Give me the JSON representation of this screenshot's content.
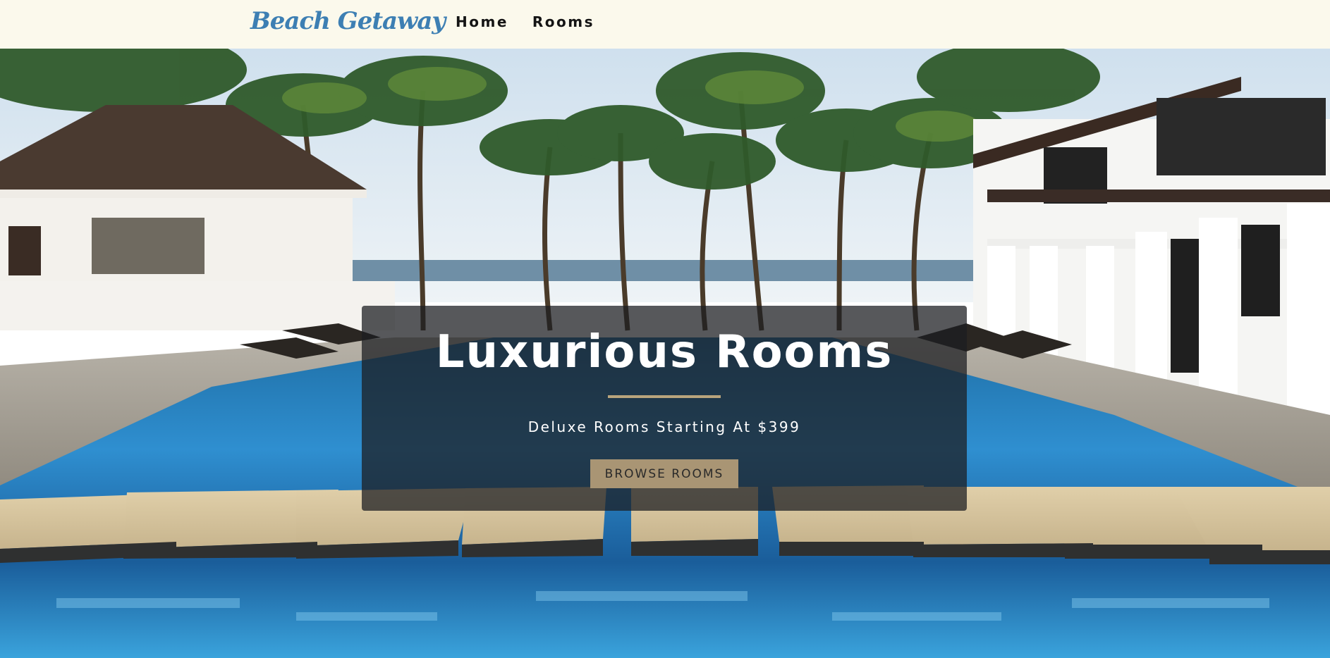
{
  "navbar": {
    "brand": "Beach Getaway",
    "links": [
      "Home",
      "Rooms"
    ]
  },
  "hero": {
    "title": "Luxurious Rooms",
    "subtitle": "Deluxe Rooms Starting At $399",
    "button_label": "BROWSE ROOMS",
    "background_description_icon": "resort-pool-palm-trees-image"
  },
  "colors": {
    "navbar_bg": "#fbf9ec",
    "brand": "#3d7fb3",
    "accent": "#b9a47c",
    "button_bg": "#a99574",
    "card_bg": "rgba(28,30,34,0.74)"
  }
}
